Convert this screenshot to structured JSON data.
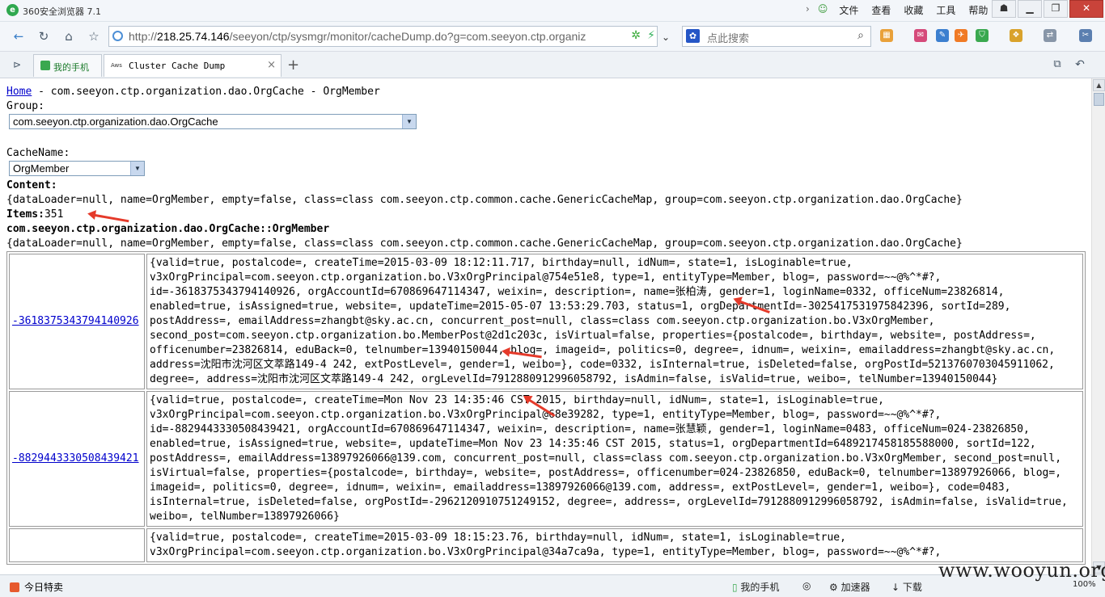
{
  "window": {
    "app_title": "360安全浏览器 7.1",
    "app_logo_glyph": "e",
    "menu": [
      "文件",
      "查看",
      "收藏",
      "工具",
      "帮助"
    ]
  },
  "address_bar": {
    "url_prefix": "http://",
    "url_host": "218.25.74.146",
    "url_path": "/seeyon/ctp/sysmgr/monitor/cacheDump.do?g=com.seeyon.ctp.organiz",
    "search_placeholder": "点此搜索"
  },
  "tabs": [
    {
      "label": "我的手机"
    },
    {
      "label": "Cluster Cache Dump",
      "icon_text": "Aws"
    }
  ],
  "page": {
    "home_link": "Home",
    "breadcrumb_rest": " - com.seeyon.ctp.organization.dao.OrgCache - OrgMember",
    "group_label": "Group:",
    "group_value": "com.seeyon.ctp.organization.dao.OrgCache",
    "cachename_label": "CacheName:",
    "cachename_value": "OrgMember",
    "content_label": "Content:",
    "content_line": "{dataLoader=null, name=OrgMember, empty=false, class=class com.seeyon.ctp.common.cache.GenericCacheMap, group=com.seeyon.ctp.organization.dao.OrgCache}",
    "items_label": "Items:",
    "items_count": "351",
    "section_title": "com.seeyon.ctp.organization.dao.OrgCache::OrgMember",
    "section_line": "{dataLoader=null, name=OrgMember, empty=false, class=class com.seeyon.ctp.common.cache.GenericCacheMap, group=com.seeyon.ctp.organization.dao.OrgCache}",
    "rows": [
      {
        "key": "-3618375343794140926",
        "value": "{valid=true, postalcode=, createTime=2015-03-09 18:12:11.717, birthday=null, idNum=, state=1, isLoginable=true, v3xOrgPrincipal=com.seeyon.ctp.organization.bo.V3xOrgPrincipal@754e51e8, type=1, entityType=Member, blog=, password=~~@%^*#?, id=-3618375343794140926, orgAccountId=670869647114347, weixin=, description=, name=张柏涛, gender=1, loginName=0332, officeNum=23826814, enabled=true, isAssigned=true, website=, updateTime=2015-05-07 13:53:29.703, status=1, orgDepartmentId=-3025417531975842396, sortId=289, postAddress=, emailAddress=zhangbt@sky.ac.cn, concurrent_post=null, class=class com.seeyon.ctp.organization.bo.V3xOrgMember, second_post=com.seeyon.ctp.organization.bo.MemberPost@2d1c203c, isVirtual=false, properties={postalcode=, birthday=, website=, postAddress=, officenumber=23826814, eduBack=0, telnumber=13940150044, blog=, imageid=, politics=0, degree=, idnum=, weixin=, emailaddress=zhangbt@sky.ac.cn, address=沈阳市沈河区文萃路149-4 242, extPostLevel=, gender=1, weibo=}, code=0332, isInternal=true, isDeleted=false, orgPostId=5213760703045911062, degree=, address=沈阳市沈河区文萃路149-4 242, orgLevelId=7912880912996058792, isAdmin=false, isValid=true, weibo=, telNumber=13940150044}"
      },
      {
        "key": "-8829443330508439421",
        "value": "{valid=true, postalcode=, createTime=Mon Nov 23 14:35:46 CST 2015, birthday=null, idNum=, state=1, isLoginable=true, v3xOrgPrincipal=com.seeyon.ctp.organization.bo.V3xOrgPrincipal@68e39282, type=1, entityType=Member, blog=, password=~~@%^*#?, id=-8829443330508439421, orgAccountId=670869647114347, weixin=, description=, name=张慧颖, gender=1, loginName=0483, officeNum=024-23826850, enabled=true, isAssigned=true, website=, updateTime=Mon Nov 23 14:35:46 CST 2015, status=1, orgDepartmentId=6489217458185588000, sortId=122, postAddress=, emailAddress=13897926066@139.com, concurrent_post=null, class=class com.seeyon.ctp.organization.bo.V3xOrgMember, second_post=null, isVirtual=false, properties={postalcode=, birthday=, website=, postAddress=, officenumber=024-23826850, eduBack=0, telnumber=13897926066, blog=, imageid=, politics=0, degree=, idnum=, weixin=, emailaddress=13897926066@139.com, address=, extPostLevel=, gender=1, weibo=}, code=0483, isInternal=true, isDeleted=false, orgPostId=-2962120910751249152, degree=, address=, orgLevelId=7912880912996058792, isAdmin=false, isValid=true, weibo=, telNumber=13897926066}"
      },
      {
        "key": "",
        "value": "{valid=true, postalcode=, createTime=2015-03-09 18:15:23.76, birthday=null, idNum=, state=1, isLoginable=true, v3xOrgPrincipal=com.seeyon.ctp.organization.bo.V3xOrgPrincipal@34a7ca9a, type=1, entityType=Member, blog=, password=~~@%^*#?,"
      }
    ]
  },
  "status_bar": {
    "left": "今日特卖",
    "items": [
      "我的手机",
      "加速器",
      "下载"
    ],
    "zoom": "100%"
  },
  "watermark": "www.wooyun.org",
  "colors": {
    "annotation_arrow": "#e53a2a",
    "link": "#0000cc",
    "brand_green": "#2fa84f"
  }
}
